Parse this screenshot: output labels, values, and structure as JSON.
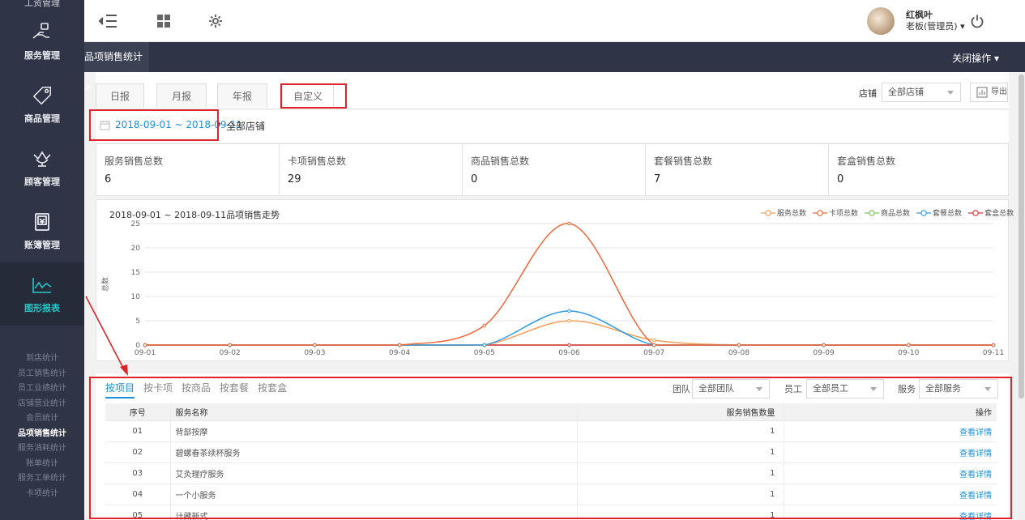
{
  "sidebar": {
    "top_label": "工资管理",
    "items": [
      {
        "label": "服务管理",
        "icon": "hand-service-icon"
      },
      {
        "label": "商品管理",
        "icon": "sale-tag-icon"
      },
      {
        "label": "顾客管理",
        "icon": "crown-icon"
      },
      {
        "label": "账簿管理",
        "icon": "ledger-icon"
      },
      {
        "label": "图形报表",
        "icon": "line-chart-icon"
      }
    ],
    "sub_items": [
      "到店统计",
      "员工销售统计",
      "员工业绩统计",
      "店铺营业统计",
      "会员统计",
      "品项销售统计",
      "服务消耗统计",
      "账单统计",
      "服务工单统计",
      "卡项统计"
    ],
    "current_sub": "品项销售统计"
  },
  "topbar": {
    "user_name": "红枫叶",
    "user_role": "老板(管理员) ▾"
  },
  "tabbar": {
    "page_tab": "品项销售统计 ×",
    "close_ops": "关闭操作 ▾"
  },
  "period": {
    "tabs": [
      "日报",
      "月报",
      "年报",
      "自定义"
    ],
    "selected": "自定义",
    "store_label": "店铺",
    "store_value": "全部店铺",
    "export_label": "导出"
  },
  "date_row": {
    "range": "2018-09-01 ~ 2018-09-11",
    "scope": "全部店铺"
  },
  "stats": [
    {
      "label": "服务销售总数",
      "value": "6"
    },
    {
      "label": "卡项销售总数",
      "value": "29"
    },
    {
      "label": "商品销售总数",
      "value": "0"
    },
    {
      "label": "套餐销售总数",
      "value": "7"
    },
    {
      "label": "套盒销售总数",
      "value": "0"
    }
  ],
  "chart_data": {
    "type": "line",
    "title": "2018-09-01 ~ 2018-09-11品项销售走势",
    "xlabel": "",
    "ylabel": "总数",
    "ylim": [
      0,
      25
    ],
    "yticks": [
      0,
      5,
      10,
      15,
      20,
      25
    ],
    "grid": true,
    "legend_position": "top-right",
    "categories": [
      "09-01",
      "09-02",
      "09-03",
      "09-04",
      "09-05",
      "09-06",
      "09-07",
      "09-08",
      "09-09",
      "09-10",
      "09-11"
    ],
    "series": [
      {
        "name": "服务总数",
        "color": "#f5a05a",
        "values": [
          0,
          0,
          0,
          0,
          0,
          5,
          1,
          0,
          0,
          0,
          0
        ]
      },
      {
        "name": "卡项总数",
        "color": "#f0673a",
        "values": [
          0,
          0,
          0,
          0,
          4,
          25,
          0,
          0,
          0,
          0,
          0
        ]
      },
      {
        "name": "商品总数",
        "color": "#7ac35a",
        "values": [
          0,
          0,
          0,
          0,
          0,
          0,
          0,
          0,
          0,
          0,
          0
        ]
      },
      {
        "name": "套餐总数",
        "color": "#2f9be0",
        "values": [
          0,
          0,
          0,
          0,
          0,
          7,
          0,
          0,
          0,
          0,
          0
        ]
      },
      {
        "name": "套盒总数",
        "color": "#e2343c",
        "values": [
          0,
          0,
          0,
          0,
          0,
          0,
          0,
          0,
          0,
          0,
          0
        ]
      }
    ]
  },
  "detail": {
    "subtabs": [
      "按项目",
      "按卡项",
      "按商品",
      "按套餐",
      "按套盒"
    ],
    "active_subtab": "按项目",
    "filters": {
      "team_label": "团队",
      "team_value": "全部团队",
      "staff_label": "员工",
      "staff_value": "全部员工",
      "service_label": "服务",
      "service_value": "全部服务"
    },
    "columns": [
      "序号",
      "服务名称",
      "服务销售数量",
      "操作"
    ],
    "rows": [
      {
        "no": "01",
        "name": "背部按摩",
        "qty": "1",
        "op": "查看详情"
      },
      {
        "no": "02",
        "name": "碧螺春茶续杯服务",
        "qty": "1",
        "op": "查看详情"
      },
      {
        "no": "03",
        "name": "艾灸理疗服务",
        "qty": "1",
        "op": "查看详情"
      },
      {
        "no": "04",
        "name": "一个小服务",
        "qty": "1",
        "op": "查看详情"
      },
      {
        "no": "05",
        "name": "计藏新式",
        "qty": "1",
        "op": "查看详情"
      }
    ]
  }
}
